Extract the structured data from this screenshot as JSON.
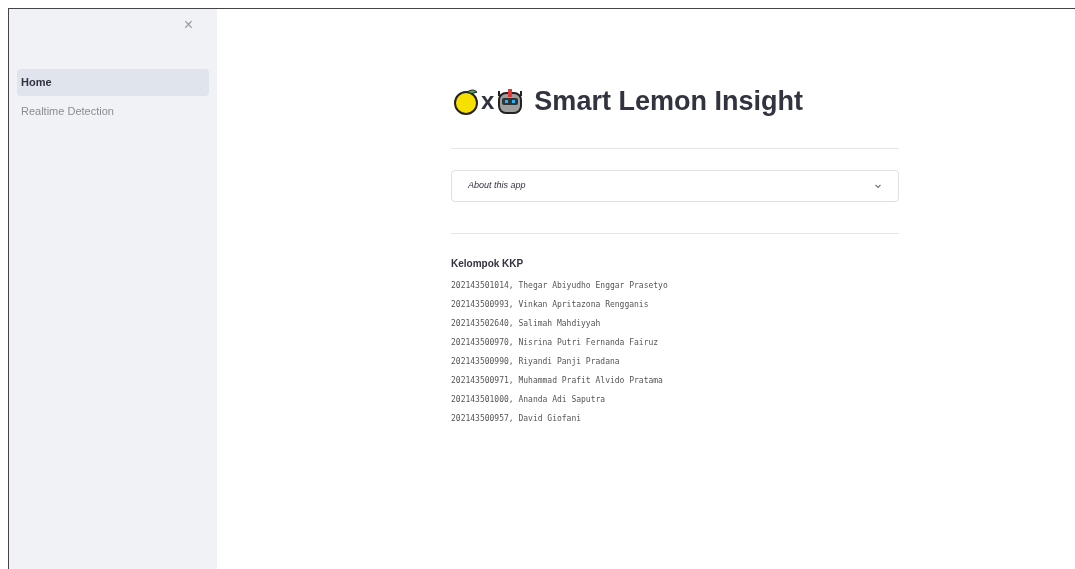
{
  "sidebar": {
    "close": "×",
    "items": [
      {
        "label": "Home",
        "selected": true
      },
      {
        "label": "Realtime Detection",
        "selected": false
      }
    ]
  },
  "header": {
    "joiner": "x",
    "title": "Smart Lemon Insight"
  },
  "expander": {
    "label": "About this app",
    "expanded": false
  },
  "team": {
    "heading": "Kelompok KKP",
    "members": [
      "202143501014, Thegar Abiyudho Enggar Prasetyo",
      "202143500993, Vinkan Apritazona Rengganis",
      "202143502640, Salimah Mahdiyyah",
      "202143500970, Nisrina Putri Fernanda Fairuz",
      "202143500990, Riyandi Panji Pradana",
      "202143500971, Muhammad Prafit Alvido Pratama",
      "202143501000, Ananda Adi Saputra",
      "202143500957, David Giofani"
    ]
  }
}
